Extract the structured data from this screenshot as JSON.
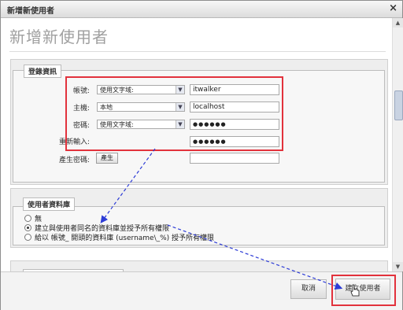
{
  "window": {
    "title": "新增新使用者",
    "close_glyph": "×"
  },
  "heading": "新增新使用者",
  "login": {
    "legend": "登錄資訊",
    "user_label": "帳號:",
    "user_select": "使用文字域:",
    "user_value": "itwalker",
    "host_label": "主機:",
    "host_select": "本地",
    "host_value": "localhost",
    "pass_label": "密碼:",
    "pass_select": "使用文字域:",
    "pass_value": "●●●●●●",
    "retype_label": "重新輸入:",
    "retype_value": "●●●●●●",
    "gen_label": "產生密碼:",
    "gen_button": "產生"
  },
  "database": {
    "legend": "使用者資料庫",
    "option_none": "無",
    "option_create": "建立與使用者同名的資料庫並授予所有權限",
    "option_wildcard": "給以 帳號_ 開頭的資料庫 (username\\_%) 授予所有權限"
  },
  "footer": {
    "cancel": "取消",
    "create": "建立使用者"
  },
  "colors": {
    "highlight": "#e2323c",
    "arrow": "#2c3bd6"
  }
}
